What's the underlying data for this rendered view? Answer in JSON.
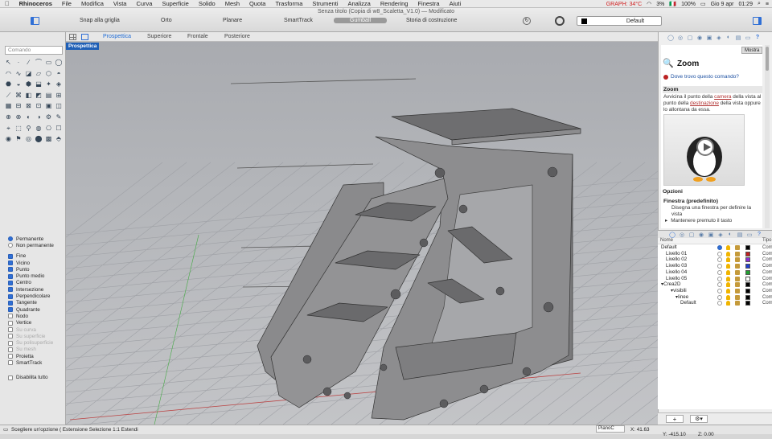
{
  "menubar": {
    "apple": "",
    "items": [
      "Rhinoceros",
      "File",
      "Modifica",
      "Vista",
      "Curva",
      "Superficie",
      "Solido",
      "Mesh",
      "Quota",
      "Trasforma",
      "Strumenti",
      "Analizza",
      "Rendering",
      "Finestra",
      "Aiuti"
    ],
    "gpu": "GRAPH: 34°C",
    "battery": "3%",
    "zoom": "100%",
    "date": "Gio 9 apr",
    "time": "01:29",
    "flag": "🇮🇹"
  },
  "window": {
    "title": "Senza titolo (Copia di w8_Scaletta_V1.0) — Modificato"
  },
  "toolbar": {
    "snap": "Snap alla griglia",
    "orto": "Orto",
    "planare": "Planare",
    "smarttrack": "SmartTrack",
    "gumball": "Gumball",
    "history": "Storia di costruzione",
    "layer": "Default"
  },
  "command": {
    "placeholder": "Comando"
  },
  "viewtabs": [
    "Prospettica",
    "Superiore",
    "Frontale",
    "Posteriore"
  ],
  "viewport": {
    "label": "Prospettica"
  },
  "osnap": {
    "modes": [
      {
        "label": "Permanente",
        "type": "radio",
        "checked": true
      },
      {
        "label": "Non permanente",
        "type": "radio",
        "checked": false
      }
    ],
    "items": [
      {
        "label": "Fine",
        "checked": true,
        "dim": false
      },
      {
        "label": "Vicino",
        "checked": true,
        "dim": false
      },
      {
        "label": "Punto",
        "checked": true,
        "dim": false
      },
      {
        "label": "Punto medio",
        "checked": true,
        "dim": false
      },
      {
        "label": "Centro",
        "checked": true,
        "dim": false
      },
      {
        "label": "Intersezione",
        "checked": true,
        "dim": false
      },
      {
        "label": "Perpendicolare",
        "checked": true,
        "dim": false
      },
      {
        "label": "Tangente",
        "checked": true,
        "dim": false
      },
      {
        "label": "Quadrante",
        "checked": true,
        "dim": false
      },
      {
        "label": "Nodo",
        "checked": false,
        "dim": false
      },
      {
        "label": "Vertice",
        "checked": false,
        "dim": false
      },
      {
        "label": "Su curva",
        "checked": false,
        "dim": true
      },
      {
        "label": "Su superficie",
        "checked": false,
        "dim": true
      },
      {
        "label": "Su polisuperficie",
        "checked": false,
        "dim": true
      },
      {
        "label": "Su mesh",
        "checked": false,
        "dim": true
      },
      {
        "label": "Proietta",
        "checked": false,
        "dim": false
      },
      {
        "label": "SmartTrack",
        "checked": false,
        "dim": false
      }
    ],
    "disable": "Disabilita tutto"
  },
  "help": {
    "mostra": "Mostra",
    "title": "Zoom",
    "where": "Dove trovo questo comando?",
    "section": "Zoom",
    "desc_pre": "Avvicina il punto della ",
    "desc_link1": "camera",
    "desc_mid": " della vista al punto della ",
    "desc_link2": "destinazione",
    "desc_post": " della vista oppure lo allontana da essa.",
    "options": "Opzioni",
    "fine_title": "Finestra (predefinito)",
    "fine_desc": "Disegna una finestra per definire la vista",
    "fine_bullet": "Mantenere premuto il tasto"
  },
  "layers": {
    "header": {
      "name": "Nome",
      "type": "Tipo"
    },
    "rows": [
      {
        "name": "Default",
        "indent": 0,
        "current": true,
        "color": "#000000",
        "mat": "Com"
      },
      {
        "name": "Livello 01",
        "indent": 1,
        "current": false,
        "color": "#c02020",
        "mat": "Com"
      },
      {
        "name": "Livello 02",
        "indent": 1,
        "current": false,
        "color": "#8a2bd6",
        "mat": "Com"
      },
      {
        "name": "Livello 03",
        "indent": 1,
        "current": false,
        "color": "#2040d0",
        "mat": "Com"
      },
      {
        "name": "Livello 04",
        "indent": 1,
        "current": false,
        "color": "#20a030",
        "mat": "Com"
      },
      {
        "name": "Livello 05",
        "indent": 1,
        "current": false,
        "color": "#ffffff",
        "mat": "Com"
      },
      {
        "name": "▾Crea2D",
        "indent": 0,
        "current": false,
        "color": "#000000",
        "mat": "Com"
      },
      {
        "name": "▾visibili",
        "indent": 2,
        "current": false,
        "color": "#000000",
        "mat": "Com"
      },
      {
        "name": "▾linee",
        "indent": 3,
        "current": false,
        "color": "#000000",
        "mat": "Com"
      },
      {
        "name": "Default",
        "indent": 4,
        "current": false,
        "color": "#000000",
        "mat": "Com"
      }
    ]
  },
  "status": {
    "prompt": "Scegliere un'opzione ( Estensione Selezione 1:1 Estendi",
    "plane": "PianoC",
    "x": "X: 41.63",
    "y": "Y: -415.10",
    "z": "Z: 0.00"
  }
}
